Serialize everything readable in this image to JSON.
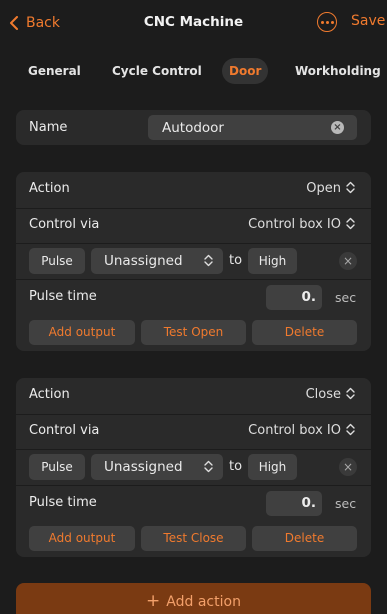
{
  "header": {
    "back_label": "Back",
    "title": "CNC Machine",
    "save_label": "Save"
  },
  "tabs": [
    {
      "label": "General"
    },
    {
      "label": "Cycle Control"
    },
    {
      "label": "Door",
      "active": true
    },
    {
      "label": "Workholding"
    }
  ],
  "name_field": {
    "label": "Name",
    "value": "Autodoor"
  },
  "actions": [
    {
      "action_label": "Action",
      "action_value": "Open",
      "control_label": "Control via",
      "control_value": "Control box IO",
      "mode": "Pulse",
      "output": "Unassigned",
      "to_label": "to",
      "level": "High",
      "pulse_label": "Pulse time",
      "pulse_value": "0.",
      "pulse_unit": "sec",
      "add_output_label": "Add output",
      "test_label": "Test Open",
      "delete_label": "Delete"
    },
    {
      "action_label": "Action",
      "action_value": "Close",
      "control_label": "Control via",
      "control_value": "Control box IO",
      "mode": "Pulse",
      "output": "Unassigned",
      "to_label": "to",
      "level": "High",
      "pulse_label": "Pulse time",
      "pulse_value": "0.",
      "pulse_unit": "sec",
      "add_output_label": "Add output",
      "test_label": "Test Close",
      "delete_label": "Delete"
    }
  ],
  "add_action_label": "Add action",
  "colors": {
    "accent": "#f07a2e",
    "background": "#1c1c1c",
    "card": "#2a2a2a",
    "control": "#404040"
  }
}
